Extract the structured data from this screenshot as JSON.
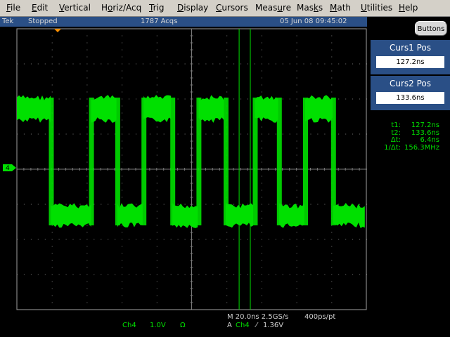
{
  "menu": [
    {
      "u": "F",
      "rest": "ile"
    },
    {
      "u": "E",
      "rest": "dit"
    },
    {
      "u": "V",
      "rest": "ertical"
    },
    {
      "pre": "H",
      "u": "o",
      "rest": "riz/Acq"
    },
    {
      "u": "T",
      "rest": "rig"
    },
    {
      "u": "D",
      "rest": "isplay"
    },
    {
      "u": "C",
      "rest": "ursors"
    },
    {
      "pre": "Meas",
      "u": "u",
      "rest": "re"
    },
    {
      "pre": "Mas",
      "u": "k",
      "rest": "s"
    },
    {
      "u": "M",
      "rest": "ath"
    },
    {
      "u": "U",
      "rest": "tilities"
    },
    {
      "u": "H",
      "rest": "elp"
    }
  ],
  "status": {
    "brand": "Tek",
    "state": "Stopped",
    "acqs": "1787 Acqs",
    "datetime": "05 Jun 08 09:45:02"
  },
  "buttons_label": "Buttons",
  "cursors": {
    "c1_title": "Curs1 Pos",
    "c1_value": "127.2ns",
    "c2_title": "Curs2 Pos",
    "c2_value": "133.6ns"
  },
  "readout": [
    {
      "label": "t1:",
      "value": "127.2ns"
    },
    {
      "label": "t2:",
      "value": "133.6ns"
    },
    {
      "label": "Δt:",
      "value": "6.4ns"
    },
    {
      "label": "1/Δt:",
      "value": "156.3MHz"
    }
  ],
  "channel_marker": "4",
  "bottom": {
    "timebase": "M 20.0ns 2.5GS/s",
    "pts": "400ps/pt",
    "trig_mode": "A",
    "trig_ch": "Ch4",
    "trig_slope": "⁄",
    "trig_level": "1.36V",
    "ch_name": "Ch4",
    "ch_scale": "1.0V",
    "ch_coupling": "Ω"
  },
  "colors": {
    "trace": "#00e000",
    "grid": "#7a7a7a",
    "panel": "#2a4f86",
    "trigger_marker": "#ff9000"
  },
  "waveform": {
    "time_per_div_ns": 20,
    "cursor1_ns": 127.2,
    "cursor2_ns": 133.6,
    "transition_times_ns": [
      19.5,
      42.5,
      57.5,
      72.5,
      89,
      104,
      119.5,
      136.2,
      150,
      165,
      181
    ],
    "start_level": "high"
  }
}
